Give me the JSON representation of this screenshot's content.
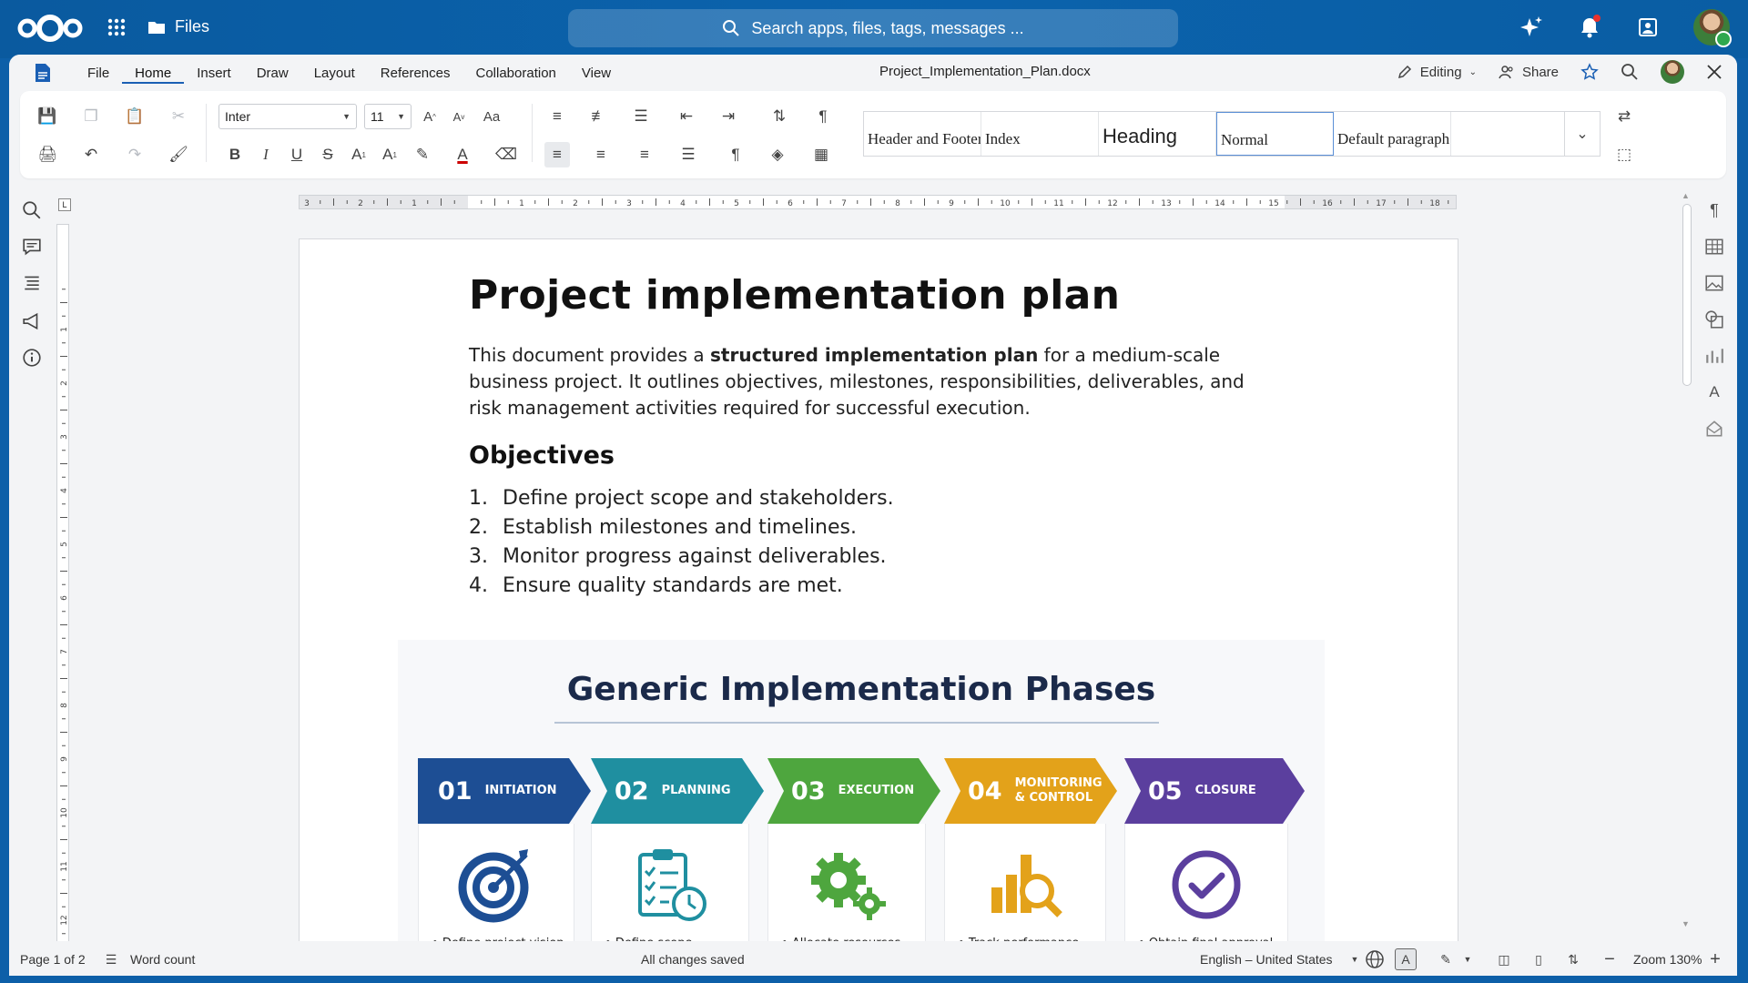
{
  "topbar": {
    "app_name": "Files",
    "search_placeholder": "Search apps, files, tags, messages ..."
  },
  "menubar": {
    "items": [
      {
        "label": "File"
      },
      {
        "label": "Home",
        "active": true
      },
      {
        "label": "Insert"
      },
      {
        "label": "Draw"
      },
      {
        "label": "Layout"
      },
      {
        "label": "References"
      },
      {
        "label": "Collaboration"
      },
      {
        "label": "View"
      }
    ],
    "document_title": "Project_Implementation_Plan.docx",
    "editing_label": "Editing",
    "share_label": "Share"
  },
  "ribbon": {
    "font_name": "Inter",
    "font_size": "11",
    "styles": [
      {
        "label": "Header and Footer"
      },
      {
        "label": "Index"
      },
      {
        "label": "Heading"
      },
      {
        "label": "Normal",
        "selected": true
      },
      {
        "label": "Default paragraph"
      },
      {
        "label": ""
      }
    ]
  },
  "document": {
    "title": "Project implementation plan",
    "intro_before": "This document provides a ",
    "intro_bold": "structured implementation plan",
    "intro_after": " for a medium-scale business project. It outlines objectives, milestones, responsibilities, deliverables, and risk management activities required for successful execution.",
    "objectives_heading": "Objectives",
    "objectives": [
      {
        "num": "1.",
        "text": "Define project scope and stakeholders."
      },
      {
        "num": "2.",
        "text": "Establish milestones and timelines."
      },
      {
        "num": "3.",
        "text": "Monitor progress against deliverables."
      },
      {
        "num": "4.",
        "text": "Ensure quality standards are met."
      }
    ],
    "infographic": {
      "title": "Generic Implementation Phases",
      "phases": [
        {
          "num": "01",
          "name": "INITIATION",
          "color": "#1d4e94",
          "icon": "target-icon",
          "bullet": "Define project vision"
        },
        {
          "num": "02",
          "name": "PLANNING",
          "color": "#1f8fa0",
          "icon": "clipboard-clock-icon",
          "bullet": "Define scope"
        },
        {
          "num": "03",
          "name": "EXECUTION",
          "color": "#4ea63e",
          "icon": "gears-icon",
          "bullet": "Allocate resources"
        },
        {
          "num": "04",
          "name": "MONITORING & CONTROL",
          "color": "#e3a21a",
          "icon": "chart-magnifier-icon",
          "bullet": "Track performance"
        },
        {
          "num": "05",
          "name": "CLOSURE",
          "color": "#5b3f9e",
          "icon": "check-circle-icon",
          "bullet": "Obtain final approval"
        }
      ]
    }
  },
  "statusbar": {
    "page": "Page 1 of 2",
    "word_count": "Word count",
    "save_status": "All changes saved",
    "language": "English – United States",
    "zoom": "Zoom 130%"
  },
  "colors": {
    "nextcloud_blue": "#0b63ad",
    "accent": "#1a5fb4"
  }
}
